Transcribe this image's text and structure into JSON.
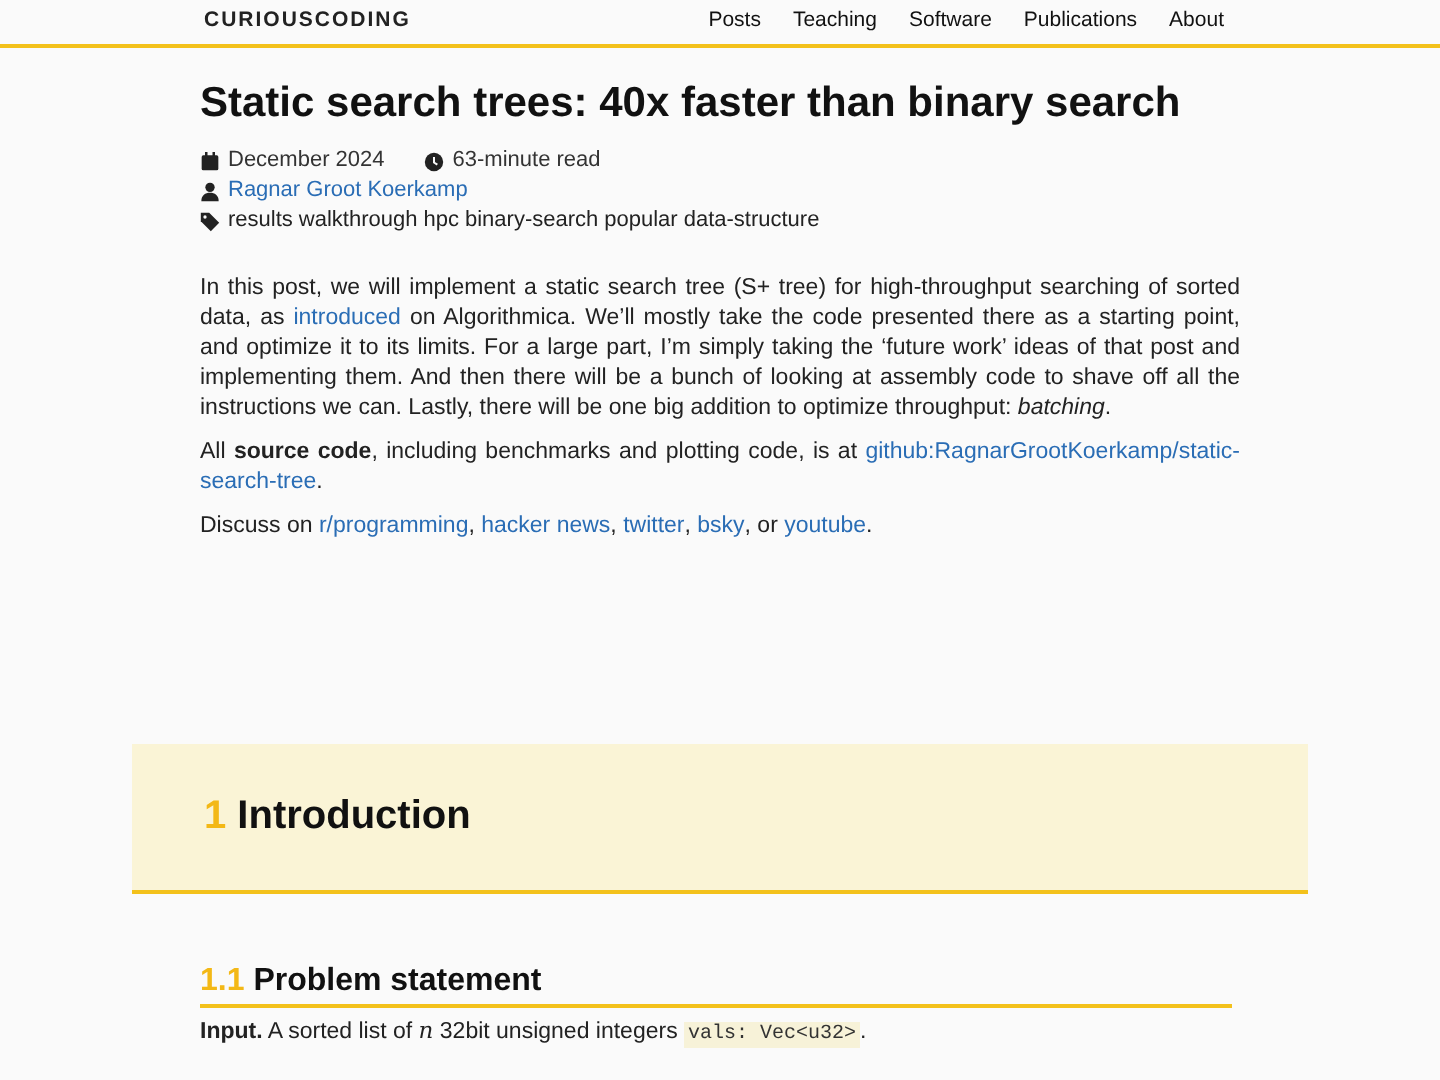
{
  "navbar": {
    "brand": "CURIOUSCODING",
    "links": [
      "Posts",
      "Teaching",
      "Software",
      "Publications",
      "About"
    ]
  },
  "post": {
    "title": "Static search trees: 40x faster than binary search",
    "date": "December 2024",
    "read_time": "63-minute read",
    "author": "Ragnar Groot Koerkamp",
    "tags": [
      "results",
      "walkthrough",
      "hpc",
      "binary-search",
      "popular",
      "data-structure"
    ]
  },
  "paragraphs": [
    [
      {
        "kind": "text",
        "text": "In this post, we will implement a static search tree (S+ tree) for high-throughput searching of sorted data, as "
      },
      {
        "kind": "link",
        "text": "introduced"
      },
      {
        "kind": "text",
        "text": " on Algorithmica. We’ll mostly take the code presented there as a starting point, and optimize it to its limits. For a large part, I’m simply taking the ‘future work’ ideas of that post and implementing them. And then there will be a bunch of looking at assembly code to shave off all the instructions we can. Lastly, there will be one big addition to optimize throughput: "
      },
      {
        "kind": "italic",
        "text": "batching"
      },
      {
        "kind": "text",
        "text": "."
      }
    ],
    [
      {
        "kind": "text",
        "text": "All "
      },
      {
        "kind": "bold",
        "text": "source code"
      },
      {
        "kind": "text",
        "text": ", including benchmarks and plotting code, is at "
      },
      {
        "kind": "link",
        "text": "github:RagnarGrootKoerkamp/static-"
      },
      {
        "kind": "link",
        "text": "search-tree"
      },
      {
        "kind": "text",
        "text": "."
      }
    ],
    [
      {
        "kind": "text",
        "text": "Discuss on "
      },
      {
        "kind": "link",
        "text": "r/programming"
      },
      {
        "kind": "text",
        "text": ", "
      },
      {
        "kind": "link",
        "text": "hacker news"
      },
      {
        "kind": "text",
        "text": ", "
      },
      {
        "kind": "link",
        "text": "twitter"
      },
      {
        "kind": "text",
        "text": ", "
      },
      {
        "kind": "link",
        "text": "bsky"
      },
      {
        "kind": "text",
        "text": ", or "
      },
      {
        "kind": "link",
        "text": "youtube"
      },
      {
        "kind": "text",
        "text": "."
      }
    ]
  ],
  "section": {
    "number": "1",
    "title": "Introduction"
  },
  "subsection": {
    "number": "1.1",
    "title": "Problem statement"
  },
  "definitions": [
    [
      {
        "kind": "bold",
        "text": "Input."
      },
      {
        "kind": "text",
        "text": " A sorted list of "
      },
      {
        "kind": "math",
        "text": "n"
      },
      {
        "kind": "text",
        "text": " 32bit unsigned integers "
      },
      {
        "kind": "code",
        "text": "vals: Vec<u32>"
      },
      {
        "kind": "text",
        "text": "."
      }
    ]
  ]
}
